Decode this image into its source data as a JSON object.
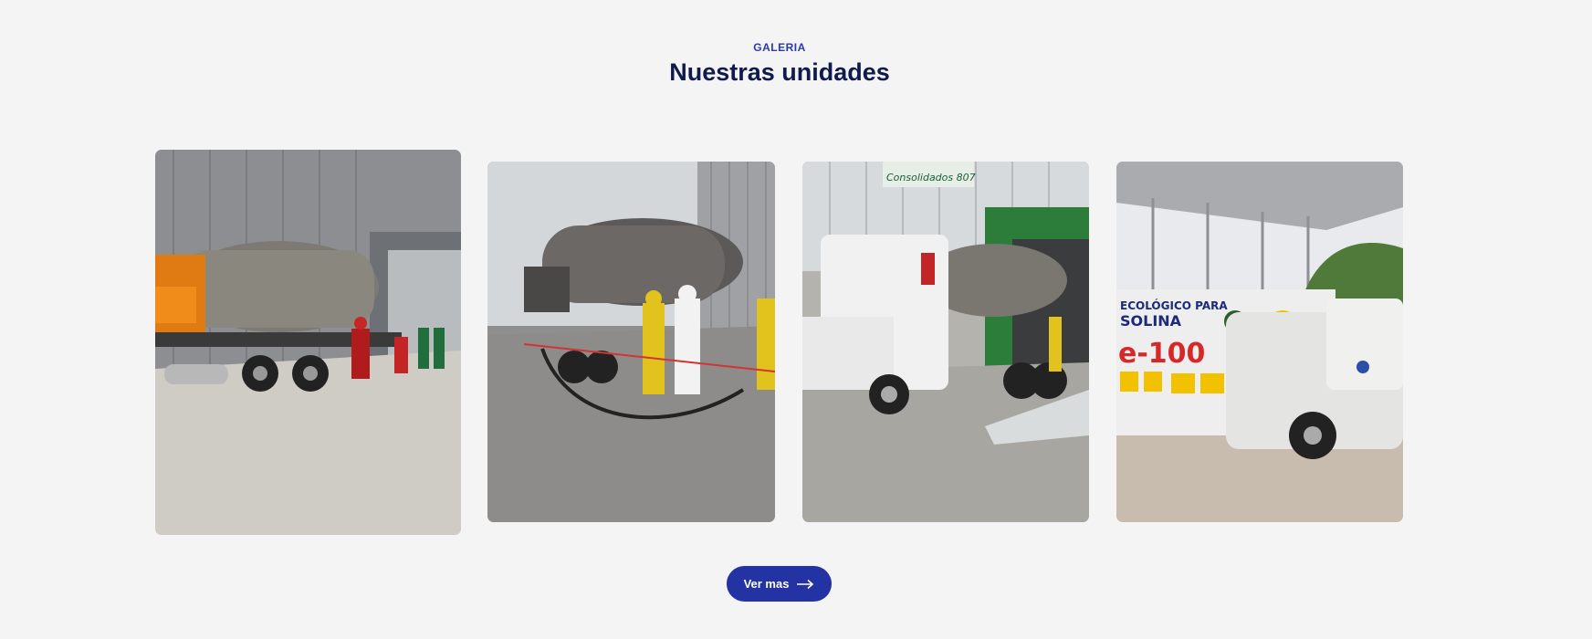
{
  "gallery": {
    "eyebrow": "GALERIA",
    "title": "Nuestras unidades",
    "button_label": "Ver mas",
    "images": [
      {
        "alt": "Unidad 1"
      },
      {
        "alt": "Unidad 2"
      },
      {
        "alt": "Unidad 3"
      },
      {
        "alt": "Unidad 4"
      }
    ]
  },
  "brand_signs": {
    "building_sign": "Consolidados 807",
    "wall_sign_line1": "ECOLÓGICO PARA",
    "wall_sign_line2": "SOLINA",
    "wall_brand": "e-100"
  },
  "colors": {
    "accent": "#2333a3",
    "title": "#0f1b4d",
    "background": "#f4f4f4"
  },
  "icons": [
    "arrow-right-icon"
  ]
}
